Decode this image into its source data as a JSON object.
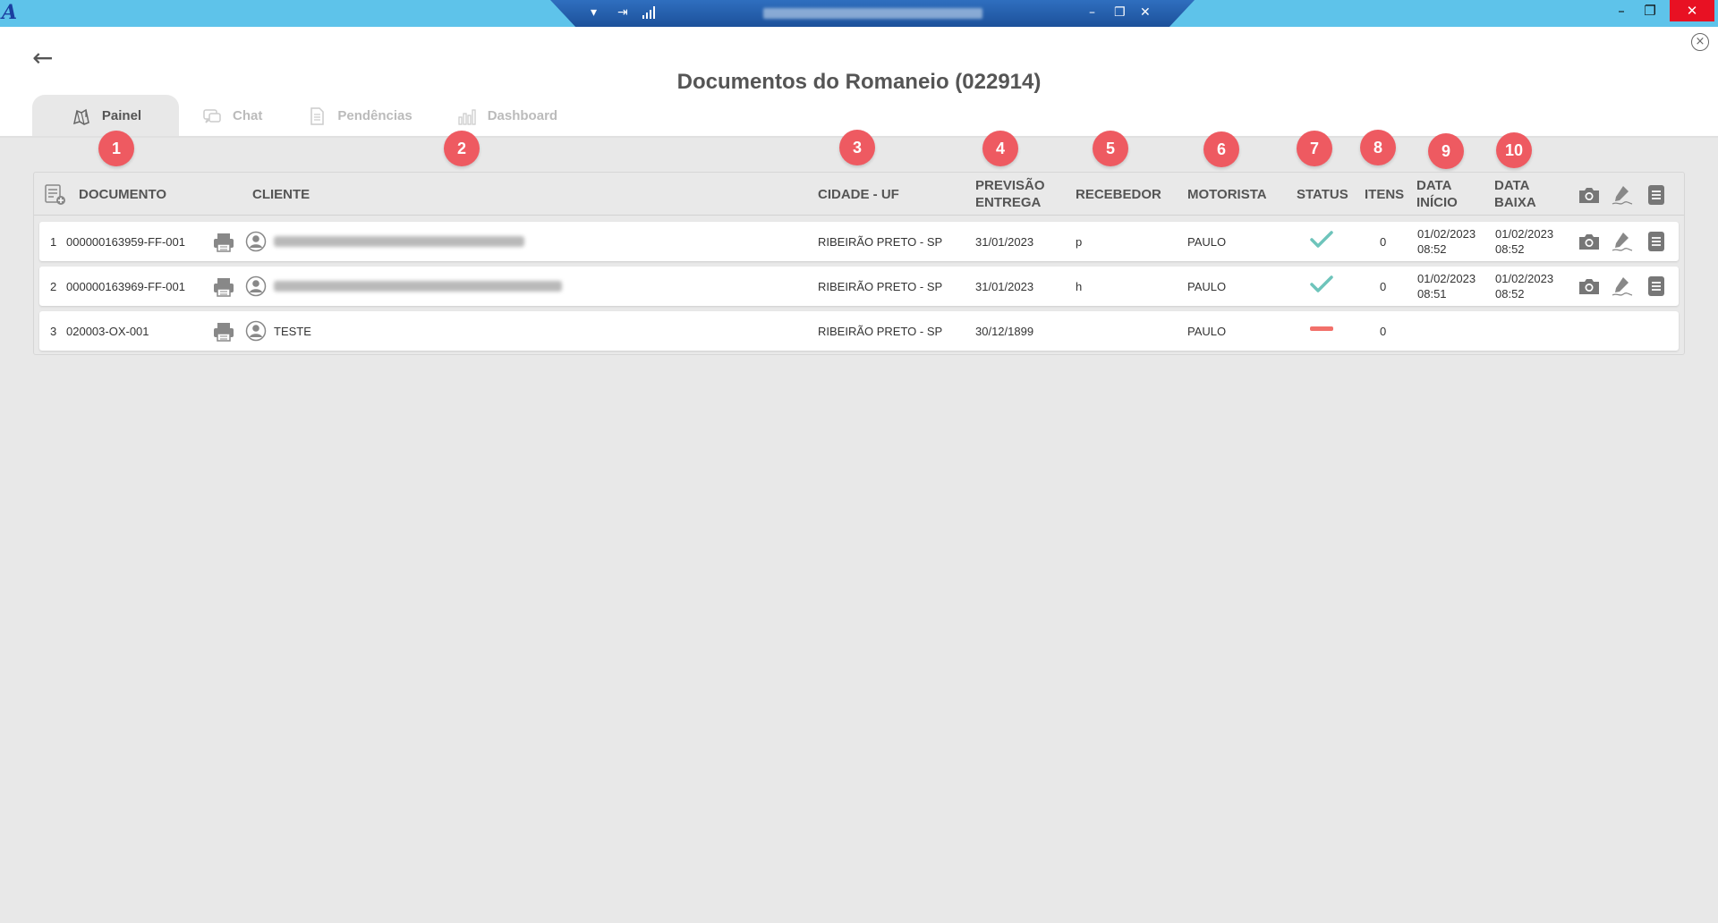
{
  "window": {
    "minimize": "–",
    "restore": "❐",
    "close": "✕"
  },
  "remote_bar": {
    "ctl_dropdown": "▾",
    "ctl_pin": "⇥",
    "ctl_min": "–",
    "ctl_restore": "❐",
    "ctl_close": "✕"
  },
  "page": {
    "back": "←",
    "close": "×",
    "title": "Documentos do Romaneio (022914)"
  },
  "tabs": [
    {
      "label": "Painel",
      "icon": "map-icon"
    },
    {
      "label": "Chat",
      "icon": "chat-icon"
    },
    {
      "label": "Pendências",
      "icon": "document-icon"
    },
    {
      "label": "Dashboard",
      "icon": "bar-chart-icon"
    }
  ],
  "badges": [
    "1",
    "2",
    "3",
    "4",
    "5",
    "6",
    "7",
    "8",
    "9",
    "10"
  ],
  "columns": {
    "documento": "DOCUMENTO",
    "cliente": "CLIENTE",
    "cidade": "CIDADE - UF",
    "previsao_1": "PREVISÃO",
    "previsao_2": "ENTREGA",
    "recebedor": "RECEBEDOR",
    "motorista": "MOTORISTA",
    "status": "STATUS",
    "itens": "ITENS",
    "inicio_1": "DATA",
    "inicio_2": "INÍCIO",
    "baixa_1": "DATA",
    "baixa_2": "BAIXA"
  },
  "rows": [
    {
      "num": "1",
      "documento": "000000163959-FF-001",
      "cliente": "",
      "cidade": "RIBEIRÃO PRETO - SP",
      "previsao": "31/01/2023",
      "recebedor": "p",
      "motorista": "PAULO",
      "status": "ok",
      "itens": "0",
      "inicio_data": "01/02/2023",
      "inicio_hora": "08:52",
      "baixa_data": "01/02/2023",
      "baixa_hora": "08:52"
    },
    {
      "num": "2",
      "documento": "000000163969-FF-001",
      "cliente": "",
      "cidade": "RIBEIRÃO PRETO - SP",
      "previsao": "31/01/2023",
      "recebedor": "h",
      "motorista": "PAULO",
      "status": "ok",
      "itens": "0",
      "inicio_data": "01/02/2023",
      "inicio_hora": "08:51",
      "baixa_data": "01/02/2023",
      "baixa_hora": "08:52"
    },
    {
      "num": "3",
      "documento": "020003-OX-001",
      "cliente": "TESTE",
      "cidade": "RIBEIRÃO PRETO - SP",
      "previsao": "30/12/1899",
      "recebedor": "",
      "motorista": "PAULO",
      "status": "pending",
      "itens": "0",
      "inicio_data": "",
      "inicio_hora": "",
      "baixa_data": "",
      "baixa_hora": ""
    }
  ],
  "colors": {
    "titlebar": "#5ec3ea",
    "badge": "#ee5a61",
    "status_ok": "#6ec4bb",
    "status_pending": "#f2706a"
  }
}
